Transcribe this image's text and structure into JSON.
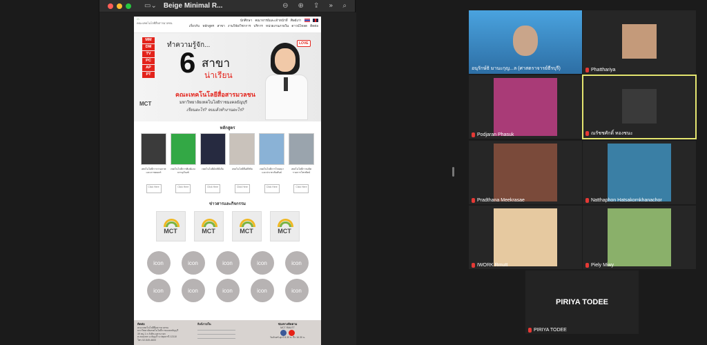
{
  "browser": {
    "title": "Beige Minimal R...",
    "sidebar_icon": "sidebar-toggle-icon",
    "toolbar_icons": [
      "zoom-out-icon",
      "zoom-in-icon",
      "share-icon",
      "more-icon",
      "search-icon"
    ]
  },
  "site": {
    "logo_text": "คณะเทคโนโลยีสื่อสารมวลชน",
    "nav_top": [
      "นักศึกษา",
      "คณาจารย์และเจ้าหน้าที่",
      "ศิษย์เก่า"
    ],
    "nav_bottom": [
      "เกี่ยวกับ",
      "หลักสูตร",
      "สาขา",
      "งานวิจัย/วิชาการ",
      "บริการ",
      "หน่วยงานภายใน",
      "ดาวน์โหลด",
      "ติดต่อ"
    ],
    "hero": {
      "tags": [
        "MM",
        "DM",
        "TV",
        "PC",
        "AP",
        "PT"
      ],
      "intro": "ทำความรู้จัก...",
      "number": "6",
      "sakha": "สาขา",
      "narian": "น่าเรียน",
      "faculty": "คณะเทคโนโลยีสื่อสารมวลชน",
      "university": "มหาวิทยาลัยเทคโนโลยีราชมงคลธัญบุรี",
      "question": "เรียนอะไร? จบแล้วทำงานอะไร?",
      "badge": "LOVE",
      "mark": "MCT"
    },
    "courses_title": "หลักสูตร",
    "courses": [
      {
        "desc": "เทคโนโลยีการถ่ายภาพและภาพยนตร์",
        "btn": "Click Here",
        "color": "#3b3b3b"
      },
      {
        "desc": "เทคโนโลยีการพิมพ์และบรรจุภัณฑ์",
        "btn": "Click Here",
        "color": "#33a845"
      },
      {
        "desc": "เทคโนโลยีมัลติมีเดีย",
        "btn": "Click Here",
        "color": "#262a40"
      },
      {
        "desc": "เทคโนโลยีสื่อดิจิทัล",
        "btn": "Click Here",
        "color": "#c9c2bb"
      },
      {
        "desc": "เทคโนโลยีการโฆษณาและประชาสัมพันธ์",
        "btn": "Click Here",
        "color": "#8ab2d6"
      },
      {
        "desc": "เทคโนโลยีการผลิตรายการโทรทัศน์",
        "btn": "Click Here",
        "color": "#9aa4ad"
      }
    ],
    "news_title": "ข่าวสารและกิจกรรม",
    "news_cards": [
      "MCT",
      "MCT",
      "MCT",
      "MCT"
    ],
    "icon_grid": [
      "icon",
      "icon",
      "icon",
      "icon",
      "icon",
      "icon",
      "icon",
      "icon",
      "icon",
      "icon"
    ],
    "footer": {
      "contact_title": "ติดต่อ",
      "contact_lines": [
        "คณะเทคโนโลยีสื่อสารมวลชน",
        "มหาวิทยาลัยเทคโนโลยีราชมงคลธัญบุรี",
        "39 หมู่ 1 ถ.รังสิต-นครนายก",
        "ต.คลองหก อ.ธัญบุรี จ.ปทุมธานี 12110",
        "โทร 02-549-4600"
      ],
      "links_title": "ลิงก์ภายใน",
      "follow_title": "ช่องทางติดตาม",
      "follow_sub": "MCT RMUTT",
      "hours": "วันจันทร์-ศุกร์ 8.30 น. ถึง 16.30 น."
    }
  },
  "gallery": {
    "tiles": [
      {
        "name": "อนุรักษ์ธิ มานะกุญ...ล (ศาสตราจารย์ธีรบุรี)",
        "active": false,
        "muted": false,
        "bg": "#3d7fb8"
      },
      {
        "name": "Phatthariya",
        "active": false,
        "muted": true,
        "bg": "#262626"
      },
      {
        "name": "Podjaran Phasuk",
        "active": false,
        "muted": true,
        "bg": "#262626"
      },
      {
        "name": "ณรัชชศักดิ์ ทองชนะ",
        "active": true,
        "muted": true,
        "bg": "#262626"
      },
      {
        "name": "Pradthana Meekrasae",
        "active": false,
        "muted": true,
        "bg": "#262626"
      },
      {
        "name": "Natthaphon Hatsakornkhanachor",
        "active": false,
        "muted": true,
        "bg": "#262626"
      },
      {
        "name": "IWORK Rmutt",
        "active": false,
        "muted": true,
        "bg": "#262626"
      },
      {
        "name": "Piely Miwy",
        "active": false,
        "muted": true,
        "bg": "#262626"
      },
      {
        "name": "PIRIYA TODEE",
        "active": false,
        "muted": true,
        "bg": "#232323",
        "big_name": "PIRIYA TODEE"
      }
    ]
  }
}
